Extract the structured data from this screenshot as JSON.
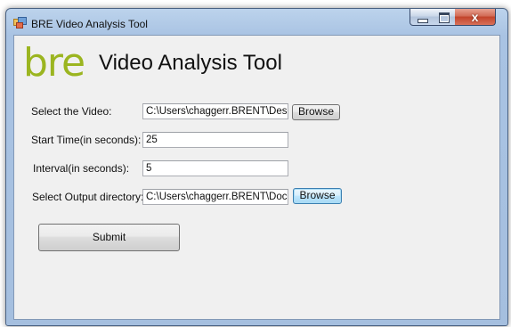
{
  "window": {
    "title": "BRE Video Analysis Tool",
    "close_glyph": "x"
  },
  "header": {
    "logo_text": "bre",
    "title": "Video Analysis Tool"
  },
  "form": {
    "video": {
      "label": "Select the Video:",
      "value": "C:\\Users\\chaggerr.BRENT\\Deskto",
      "browse_label": "Browse"
    },
    "start_time": {
      "label": "Start Time(in seconds):",
      "value": "25"
    },
    "interval": {
      "label": "Interval(in seconds):",
      "value": "5"
    },
    "output": {
      "label": "Select Output directory:",
      "value": "C:\\Users\\chaggerr.BRENT\\Docum",
      "browse_label": "Browse"
    },
    "submit_label": "Submit"
  },
  "colors": {
    "logo": "#9bb520",
    "titlebar": "#a9c3e3",
    "client_background": "#f0f0f0",
    "close_button": "#c2432a"
  },
  "icons": {
    "app": "app-window-icon",
    "minimize": "minimize-icon",
    "maximize": "maximize-icon",
    "close": "close-icon"
  }
}
